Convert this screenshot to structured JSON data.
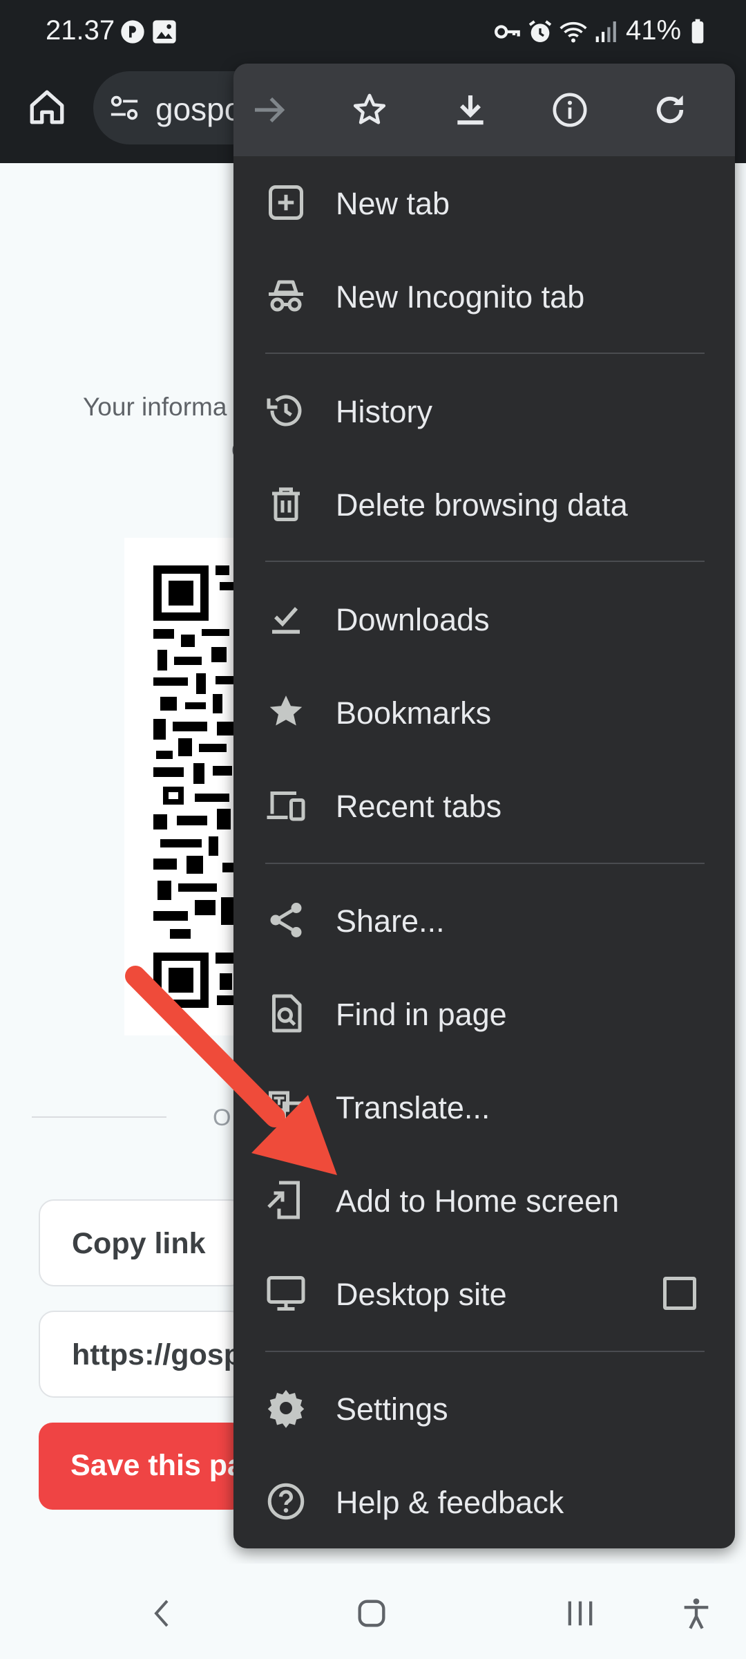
{
  "status_bar": {
    "time": "21.37",
    "battery": "41%",
    "left_icons": [
      "vpn-icon",
      "gallery-icon"
    ],
    "right_icons": [
      "key-icon",
      "alarm-icon",
      "wifi-icon",
      "signal-icon",
      "battery-icon"
    ]
  },
  "toolbar": {
    "url_partial": "gospo"
  },
  "page": {
    "info_text": "Your informa",
    "info_text_2": "c",
    "or_text": "O",
    "copy_link_label": "Copy link",
    "url_field_value": "https://gosp",
    "save_button_label": "Save this pa"
  },
  "menu": {
    "top_icons": [
      "forward-icon",
      "bookmark-star-icon",
      "download-icon",
      "info-icon",
      "refresh-icon"
    ],
    "items": [
      {
        "label": "New tab",
        "icon": "new-tab-icon"
      },
      {
        "label": "New Incognito tab",
        "icon": "incognito-icon"
      },
      {
        "label": "History",
        "icon": "history-icon"
      },
      {
        "label": "Delete browsing data",
        "icon": "trash-icon"
      },
      {
        "label": "Downloads",
        "icon": "downloads-icon"
      },
      {
        "label": "Bookmarks",
        "icon": "bookmarks-star-icon"
      },
      {
        "label": "Recent tabs",
        "icon": "devices-icon"
      },
      {
        "label": "Share...",
        "icon": "share-icon"
      },
      {
        "label": "Find in page",
        "icon": "find-in-page-icon"
      },
      {
        "label": "Translate...",
        "icon": "translate-icon"
      },
      {
        "label": "Add to Home screen",
        "icon": "add-to-home-icon"
      },
      {
        "label": "Desktop site",
        "icon": "desktop-icon"
      },
      {
        "label": "Settings",
        "icon": "settings-gear-icon"
      },
      {
        "label": "Help & feedback",
        "icon": "help-icon"
      }
    ],
    "desktop_site_checked": false
  },
  "colors": {
    "menu_bg": "#2b2c2e",
    "menu_text": "#e8eaed",
    "arrow": "#ef4b3a",
    "save_button": "#ef4444"
  },
  "navbar": {
    "icons": [
      "back-icon",
      "home-nav-icon",
      "recents-icon",
      "accessibility-icon"
    ]
  }
}
